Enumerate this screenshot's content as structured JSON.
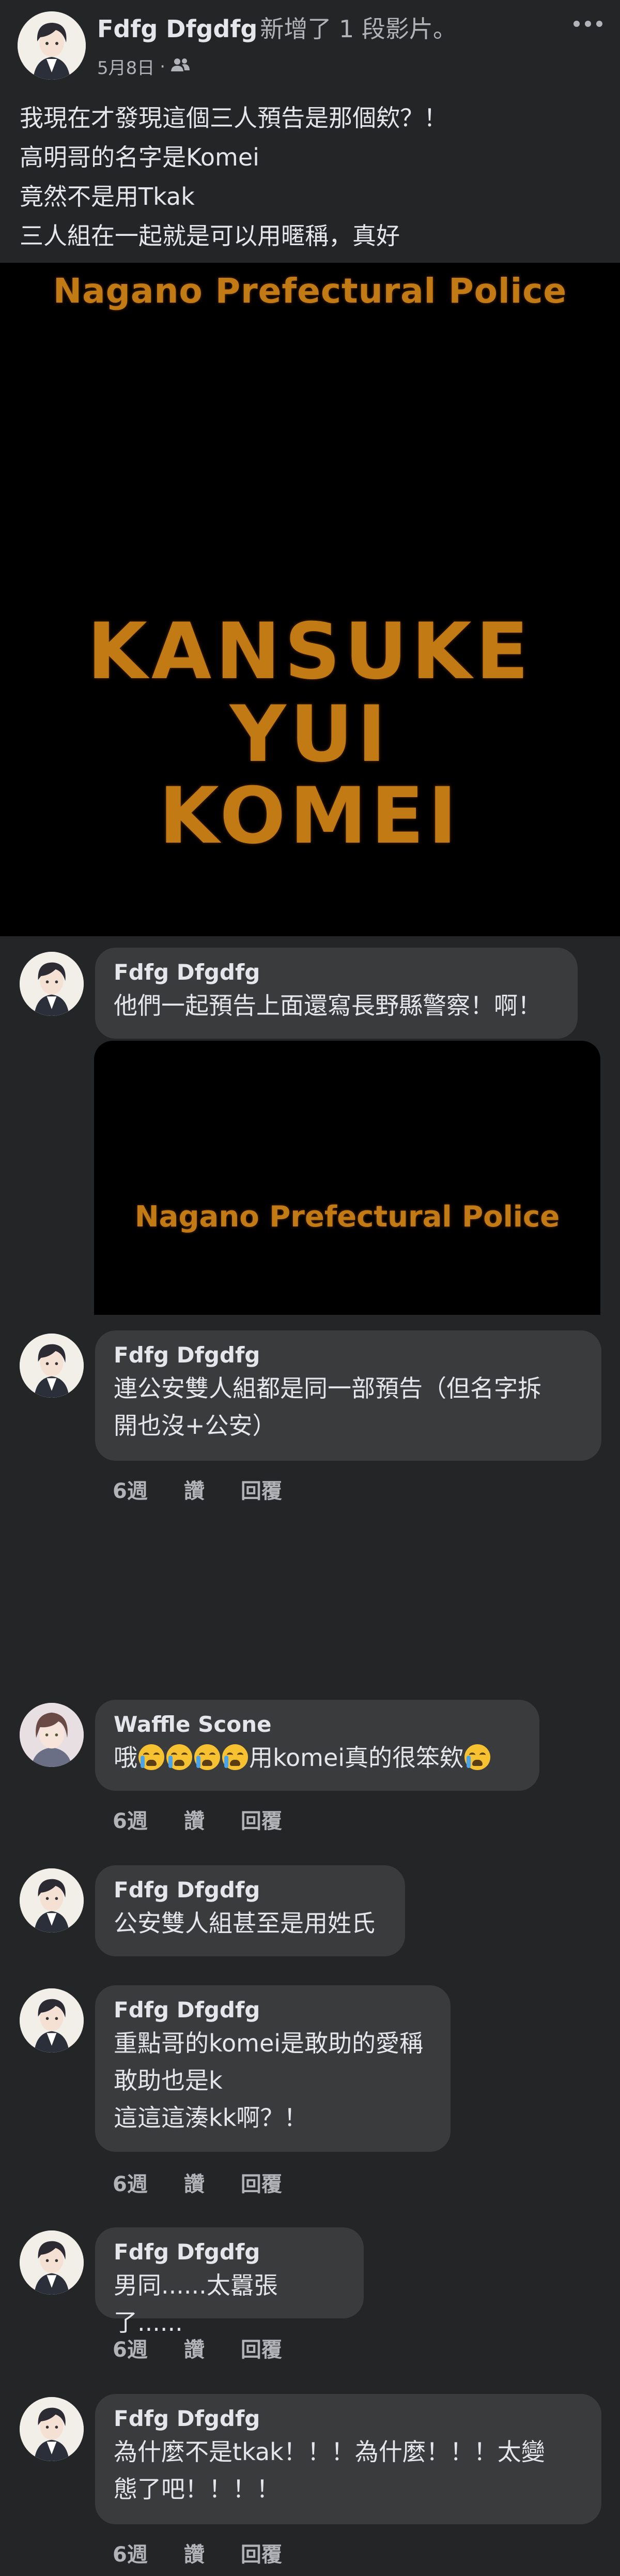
{
  "post": {
    "author": "Fdfg Dfgdfg",
    "action": "新增了 1 段影片。",
    "date": "5月8日",
    "date_sep": "·",
    "audience_icon": "friends-icon",
    "lines": "我現在才發現這個三人預告是那個欸？！\n高明哥的名字是Komei\n竟然不是用Tkak\n三人組在一起就是可以用暱稱，真好",
    "video": {
      "top_text": "Nagano Prefectural Police",
      "names": [
        "KANSUKE",
        "YUI",
        "KOMEI"
      ]
    }
  },
  "comments": [
    {
      "name": "Fdfg Dfgdfg",
      "text": "他們一起預告上面還寫長野縣警察！啊！",
      "attachment_text": "Nagano Prefectural Police"
    },
    {
      "name": "Fdfg Dfgdfg",
      "text": "連公安雙人組都是同一部預告（但名字拆\n開也沒+公安）",
      "time": "6週",
      "like": "讚",
      "reply": "回覆"
    },
    {
      "name": "Waffle Scone",
      "text_before": "哦",
      "text_middle": "用komei真的很笨欸",
      "emoji": "crying-face-emoji",
      "time": "6週",
      "like": "讚",
      "reply": "回覆"
    },
    {
      "name": "Fdfg Dfgdfg",
      "text": "公安雙人組甚至是用姓氏"
    },
    {
      "name": "Fdfg Dfgdfg",
      "text": "重點哥的komei是敢助的愛稱\n敢助也是k\n這這這湊kk啊？！",
      "time": "6週",
      "like": "讚",
      "reply": "回覆"
    },
    {
      "name": "Fdfg Dfgdfg",
      "text": "男同......太囂張了......",
      "time": "6週",
      "like": "讚",
      "reply": "回覆"
    },
    {
      "name": "Fdfg Dfgdfg",
      "text": "為什麼不是tkak！！！為什麼！！！太變\n態了吧！！！！",
      "time": "6週",
      "like": "讚",
      "reply": "回覆"
    }
  ],
  "colors": {
    "background": "#242526",
    "bubble": "#3a3b3c",
    "text": "#e4e6eb",
    "secondary": "#b0b3b8",
    "video_text": "#c27a14"
  }
}
